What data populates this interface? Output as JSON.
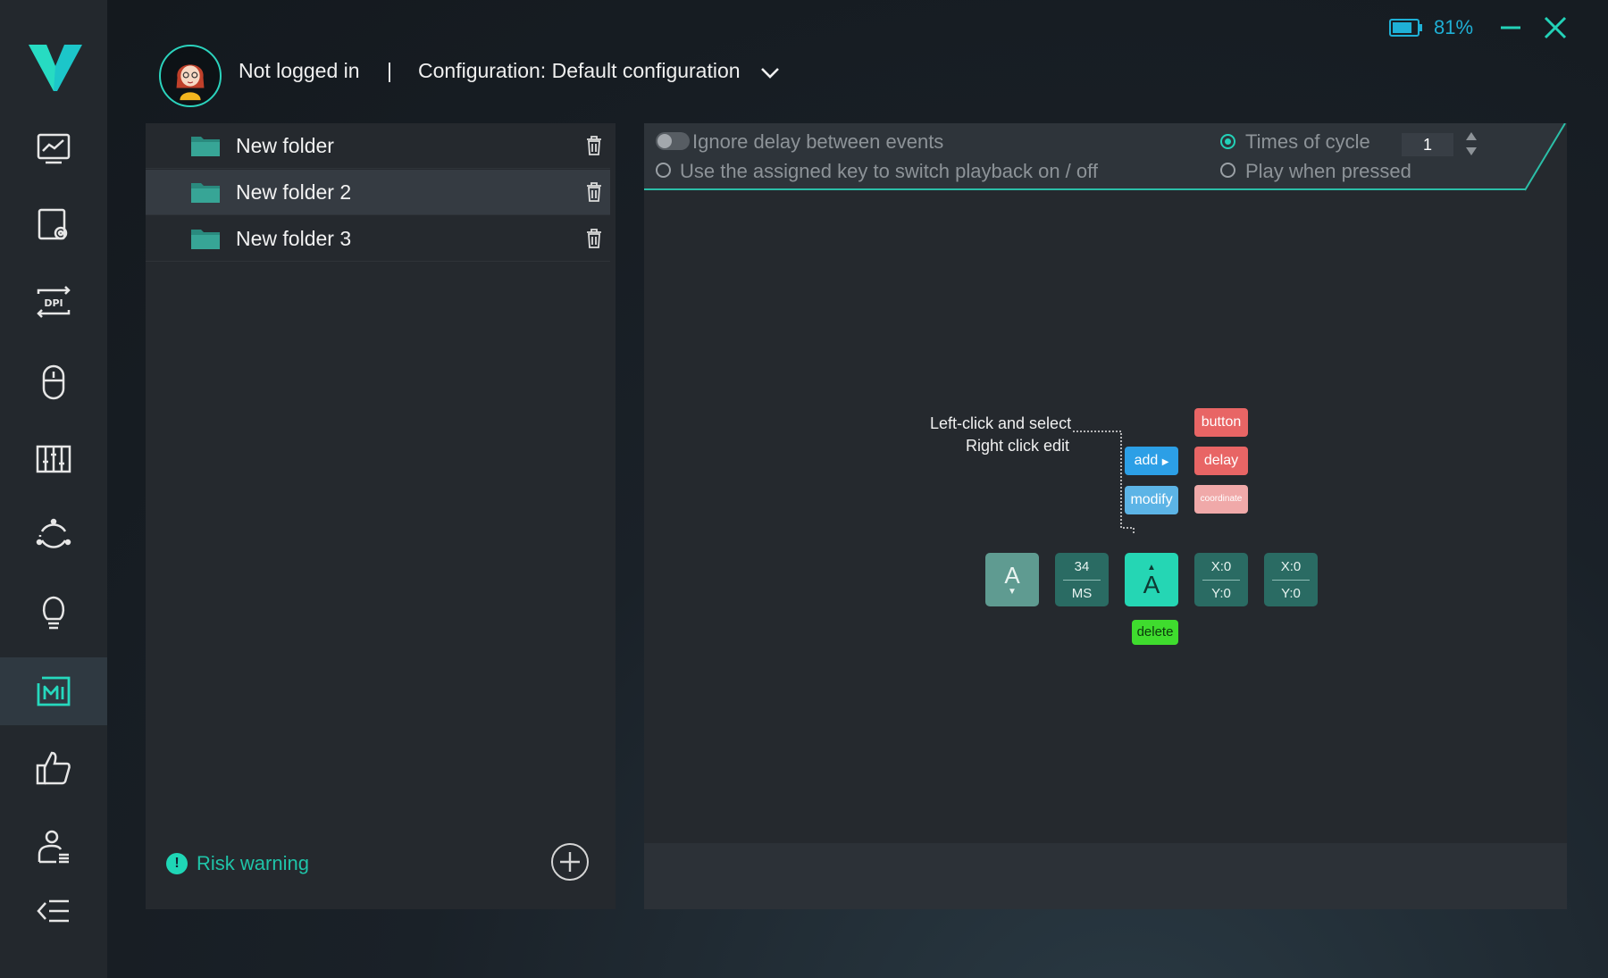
{
  "header": {
    "user_status": "Not logged in",
    "separator": "|",
    "configuration": "Configuration: Default configuration"
  },
  "battery": {
    "percent": "81%",
    "level": 0.81
  },
  "sidebar": {
    "items": [
      {
        "icon": "performance-chart-icon"
      },
      {
        "icon": "screen-settings-icon"
      },
      {
        "icon": "dpi-icon"
      },
      {
        "icon": "mouse-icon"
      },
      {
        "icon": "equalizer-icon"
      },
      {
        "icon": "sync-cycle-icon"
      },
      {
        "icon": "lightbulb-icon"
      },
      {
        "icon": "macro-icon",
        "active": true
      },
      {
        "icon": "thumbs-up-icon"
      },
      {
        "icon": "user-profile-icon"
      },
      {
        "icon": "collapse-menu-icon"
      }
    ]
  },
  "folders": [
    {
      "label": "New folder"
    },
    {
      "label": "New folder 2",
      "selected": true
    },
    {
      "label": "New folder 3"
    }
  ],
  "left_footer": {
    "risk_warning": "Risk warning",
    "risk_icon_glyph": "!"
  },
  "options": {
    "ignore_delay": "Ignore delay between events",
    "assigned_key": "Use the assigned key to switch playback on / off",
    "times_of_cycle": "Times of cycle",
    "cycle_value": "1",
    "play_when_pressed": "Play when pressed"
  },
  "guide": {
    "line1": "Left-click and select",
    "line2": "Right click edit",
    "add": "add",
    "modify": "modify",
    "button": "button",
    "delay": "delay",
    "coordinate": "coordinate",
    "delete": "delete",
    "tiles": {
      "key_down": "A",
      "delay_value": "34",
      "delay_unit": "MS",
      "key_up": "A",
      "coord1_x": "X:0",
      "coord1_y": "Y:0",
      "coord2_x": "X:0",
      "coord2_y": "Y:0"
    }
  },
  "colors": {
    "accent": "#23d2b8",
    "sidebar_bg": "#23282d",
    "panel_bg": "#25292e",
    "tag_blue": "#2c9fe6",
    "tag_light_blue": "#5cb4e6",
    "tag_red": "#e86565",
    "tag_pink": "#f0a9a9",
    "tag_green": "#3fdc2e",
    "tile_teal": "#2a6b63",
    "tile_bright": "#25d6b4"
  }
}
